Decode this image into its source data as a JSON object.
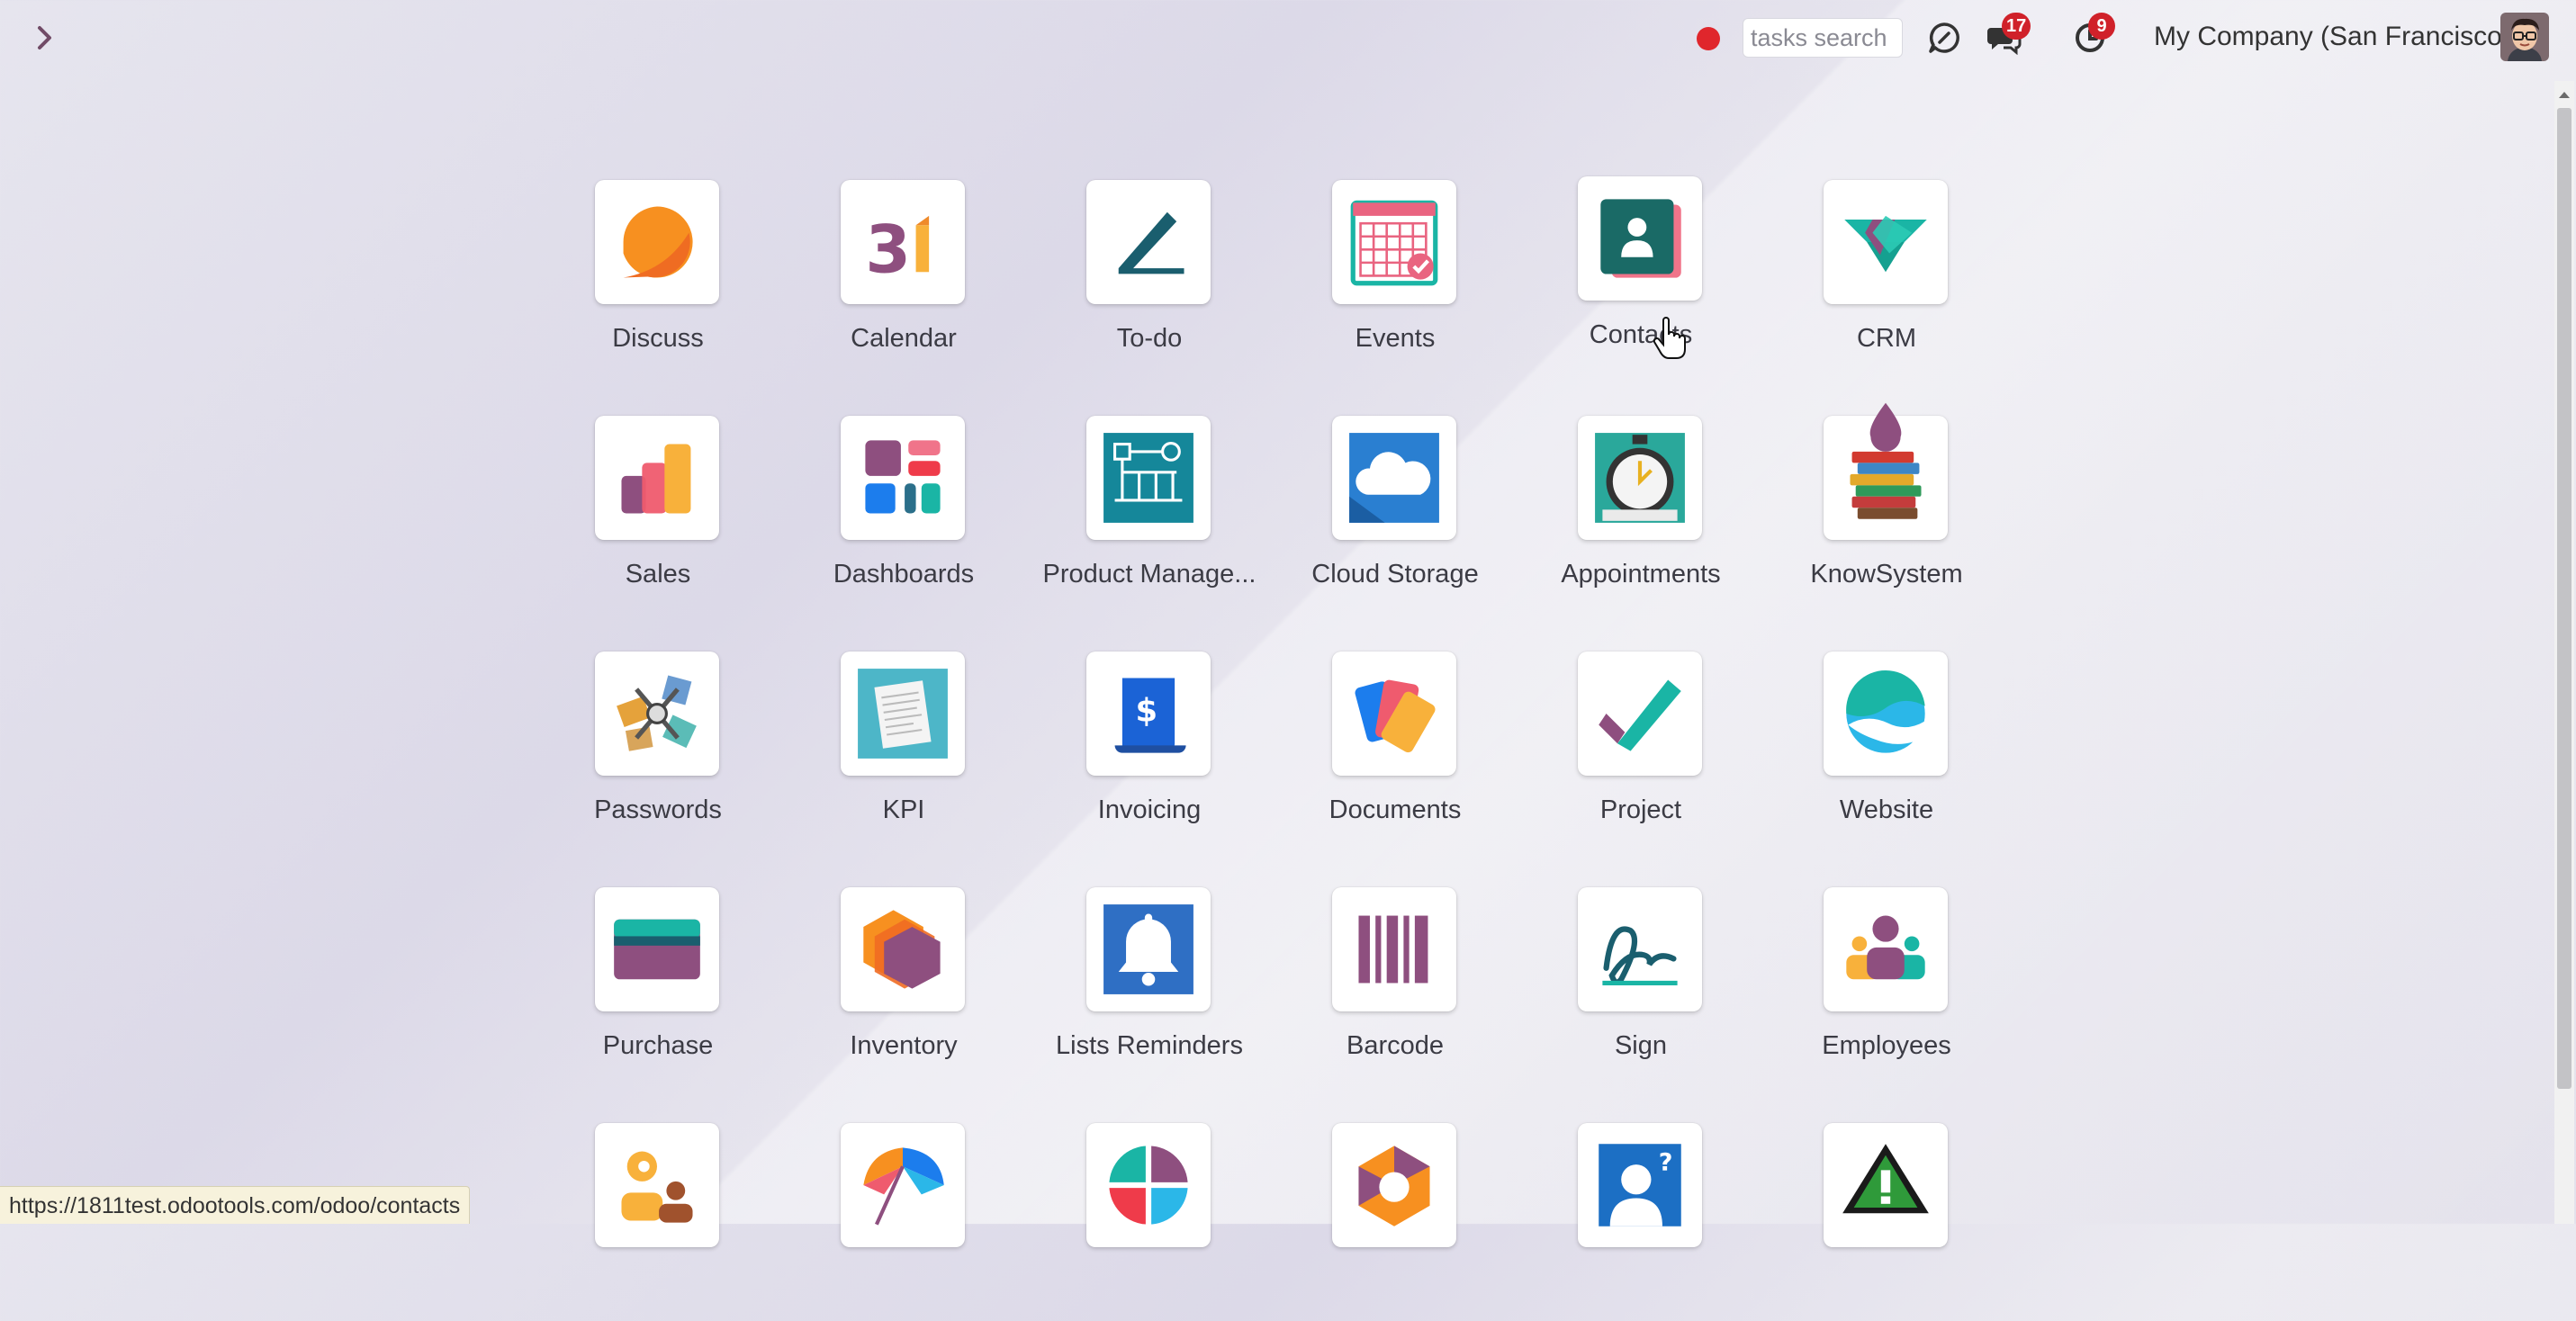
{
  "topbar": {
    "search_placeholder": "tasks search",
    "messages_count": "17",
    "activities_count": "9",
    "company": "My Company (San Francisco)"
  },
  "apps": [
    {
      "label": "Discuss",
      "icon": "discuss-icon"
    },
    {
      "label": "Calendar",
      "icon": "calendar-icon"
    },
    {
      "label": "To-do",
      "icon": "todo-icon"
    },
    {
      "label": "Events",
      "icon": "events-icon"
    },
    {
      "label": "Contacts",
      "icon": "contacts-icon"
    },
    {
      "label": "CRM",
      "icon": "crm-icon"
    },
    {
      "label": "Sales",
      "icon": "sales-icon"
    },
    {
      "label": "Dashboards",
      "icon": "dashboards-icon"
    },
    {
      "label": "Product Manage...",
      "icon": "product-management-icon"
    },
    {
      "label": "Cloud Storage",
      "icon": "cloud-storage-icon"
    },
    {
      "label": "Appointments",
      "icon": "appointments-icon"
    },
    {
      "label": "KnowSystem",
      "icon": "knowsystem-icon"
    },
    {
      "label": "Passwords",
      "icon": "passwords-icon"
    },
    {
      "label": "KPI",
      "icon": "kpi-icon"
    },
    {
      "label": "Invoicing",
      "icon": "invoicing-icon"
    },
    {
      "label": "Documents",
      "icon": "documents-icon"
    },
    {
      "label": "Project",
      "icon": "project-icon"
    },
    {
      "label": "Website",
      "icon": "website-icon"
    },
    {
      "label": "Purchase",
      "icon": "purchase-icon"
    },
    {
      "label": "Inventory",
      "icon": "inventory-icon"
    },
    {
      "label": "Lists Reminders",
      "icon": "lists-reminders-icon"
    },
    {
      "label": "Barcode",
      "icon": "barcode-icon"
    },
    {
      "label": "Sign",
      "icon": "sign-icon"
    },
    {
      "label": "Employees",
      "icon": "employees-icon"
    },
    {
      "label": "",
      "icon": "recruitment-icon"
    },
    {
      "label": "",
      "icon": "insurance-icon"
    },
    {
      "label": "",
      "icon": "surveys-icon"
    },
    {
      "label": "",
      "icon": "helpdesk-icon"
    },
    {
      "label": "",
      "icon": "user-help-icon"
    },
    {
      "label": "",
      "icon": "warning-icon"
    }
  ],
  "status_url": "https://1811test.odootools.com/odoo/contacts",
  "colors": {
    "odoo_purple": "#714b67",
    "badge_red": "#d0212a",
    "teal": "#1ab5a5"
  }
}
